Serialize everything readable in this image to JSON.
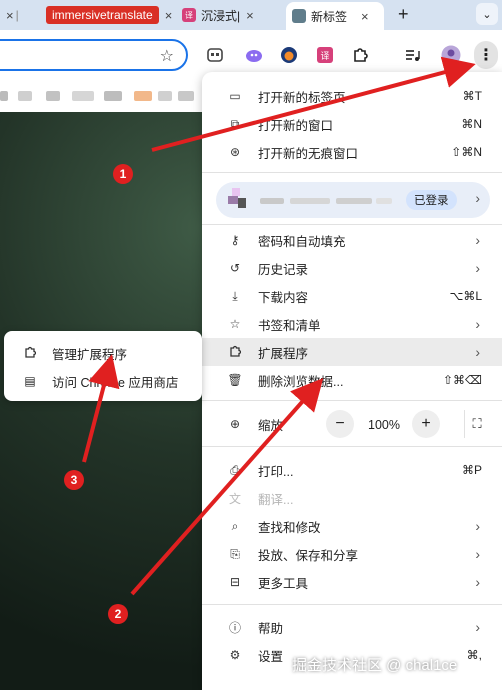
{
  "tabs": [
    {
      "label": "",
      "close": "×"
    },
    {
      "label": "immersivetranslate",
      "close": "×"
    },
    {
      "label": "沉浸式|",
      "close": "×"
    },
    {
      "label": "新标签",
      "close": "×"
    }
  ],
  "new_tab": "+",
  "tab_search": "⌄",
  "menu": {
    "items_top": [
      {
        "label": "打开新的标签页",
        "shortcut": "⌘T",
        "icon": "new-tab-icon"
      },
      {
        "label": "打开新的窗口",
        "shortcut": "⌘N",
        "icon": "new-window-icon"
      },
      {
        "label": "打开新的无痕窗口",
        "shortcut": "⇧⌘N",
        "icon": "incognito-icon"
      }
    ],
    "profile": {
      "login": "已登录"
    },
    "items_mid": [
      {
        "label": "密码和自动填充",
        "icon": "key-icon"
      },
      {
        "label": "历史记录",
        "icon": "history-icon"
      },
      {
        "label": "下载内容",
        "shortcut": "⌥⌘L",
        "icon": "download-icon"
      },
      {
        "label": "书签和清单",
        "icon": "bookmark-star-icon"
      },
      {
        "label": "扩展程序",
        "icon": "puzzle-icon"
      },
      {
        "label": "删除浏览数据...",
        "shortcut": "⇧⌘⌫",
        "icon": "trash-icon"
      }
    ],
    "zoom": {
      "label": "缩放",
      "value": "100%",
      "minus": "−",
      "plus": "+"
    },
    "items_tools": [
      {
        "label": "打印...",
        "shortcut": "⌘P",
        "icon": "print-icon"
      },
      {
        "label": "翻译...",
        "icon": "translate-icon"
      },
      {
        "label": "查找和修改",
        "icon": "find-icon"
      },
      {
        "label": "投放、保存和分享",
        "icon": "cast-icon"
      },
      {
        "label": "更多工具",
        "icon": "toolbox-icon"
      }
    ],
    "items_bottom": [
      {
        "label": "帮助",
        "icon": "help-icon"
      },
      {
        "label": "设置",
        "shortcut": "⌘,",
        "icon": "settings-icon"
      }
    ]
  },
  "submenu": {
    "items": [
      {
        "label": "管理扩展程序",
        "icon": "puzzle-icon"
      },
      {
        "label": "访问 Chrome 应用商店",
        "icon": "store-icon"
      }
    ]
  },
  "annotations": {
    "badges": [
      "1",
      "2",
      "3"
    ],
    "color": "#e02020"
  },
  "watermark": "掘金技术社区 @ chal1ce"
}
